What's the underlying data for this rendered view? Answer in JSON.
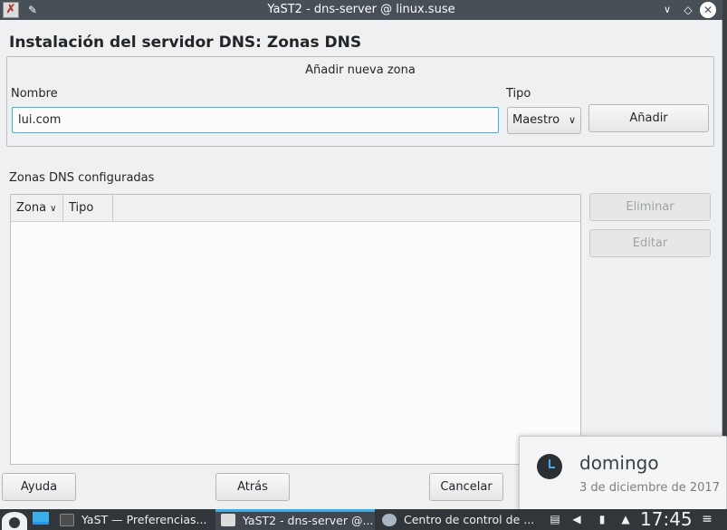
{
  "window": {
    "title": "YaST2 - dns-server @ linux.suse",
    "page_title": "Instalación del servidor DNS: Zonas DNS"
  },
  "add_zone": {
    "group_title": "Añadir nueva zona",
    "name_label": "Nombre",
    "name_value": "lui.com",
    "type_label": "Tipo",
    "type_value": "Maestro",
    "add_button": "Añadir"
  },
  "zones": {
    "section_label": "Zonas DNS configuradas",
    "columns": [
      "Zona",
      "Tipo"
    ],
    "rows": [],
    "delete_button": "Eliminar",
    "edit_button": "Editar"
  },
  "footer": {
    "help": "Ayuda",
    "back": "Atrás",
    "cancel": "Cancelar"
  },
  "notification": {
    "title": "domingo",
    "body": "3 de diciembre de 2017"
  },
  "taskbar": {
    "tasks": [
      {
        "label": "YaST — Preferencias...",
        "icon": "terminal-icon",
        "active": false
      },
      {
        "label": "YaST2 - dns-server @...",
        "icon": "yast-icon",
        "active": true
      },
      {
        "label": "Centro de control de ...",
        "icon": "control-center-icon",
        "active": false
      }
    ],
    "clock": "17:45"
  },
  "colors": {
    "accent": "#3daee9",
    "titlebar": "#475057",
    "taskbar": "#31363b"
  }
}
